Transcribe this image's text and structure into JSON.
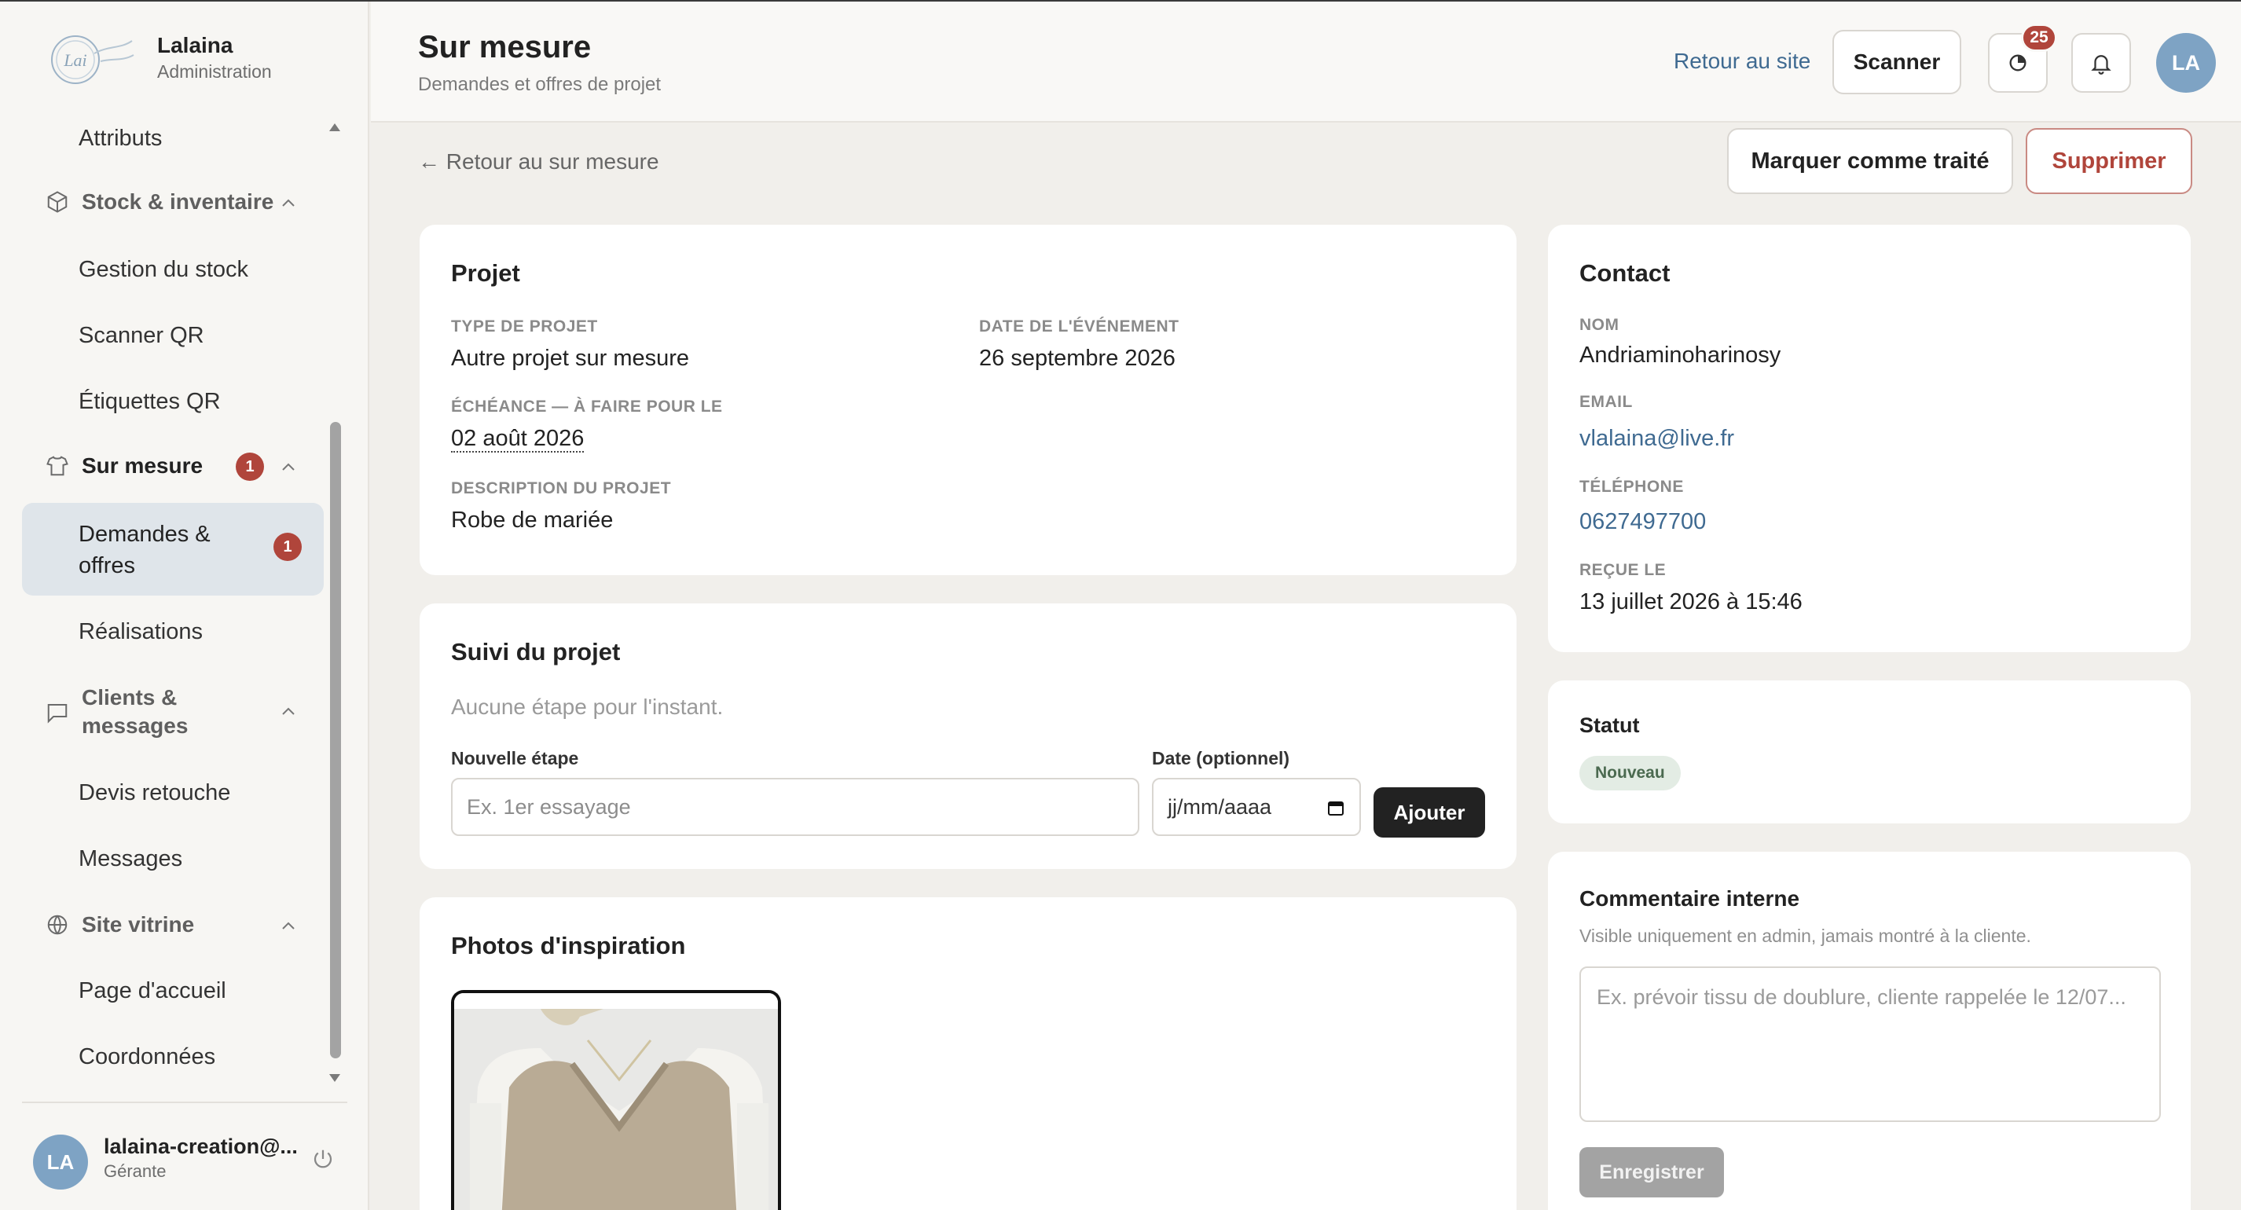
{
  "app": {
    "name": "Lalaina",
    "role": "Administration"
  },
  "sidebar": {
    "items": {
      "attributs": "Attributs",
      "stock_group": "Stock & inventaire",
      "gestion_stock": "Gestion du stock",
      "scanner_qr": "Scanner QR",
      "etiquettes_qr": "Étiquettes QR",
      "sur_mesure_group": "Sur mesure",
      "sur_mesure_badge": "1",
      "demandes_line1": "Demandes &",
      "demandes_line2": "offres",
      "demandes_badge": "1",
      "realisations": "Réalisations",
      "clients_line1": "Clients &",
      "clients_line2": "messages",
      "devis_retouche": "Devis retouche",
      "messages": "Messages",
      "site_group": "Site vitrine",
      "page_accueil": "Page d'accueil",
      "coordonnees": "Coordonnées"
    },
    "user": {
      "initials": "LA",
      "email": "lalaina-creation@...",
      "role": "Gérante"
    }
  },
  "header": {
    "title": "Sur mesure",
    "subtitle": "Demandes et offres de projet",
    "back_site": "Retour au site",
    "scanner": "Scanner",
    "notif_count": "25",
    "avatar": "LA"
  },
  "actions": {
    "back": "← Retour au sur mesure",
    "mark_done": "Marquer comme traité",
    "delete": "Supprimer"
  },
  "projet": {
    "title": "Projet",
    "type_label": "TYPE DE PROJET",
    "type_value": "Autre projet sur mesure",
    "date_label": "DATE DE L'ÉVÉNEMENT",
    "date_value": "26 septembre 2026",
    "echeance_label": "ÉCHÉANCE — À FAIRE POUR LE",
    "echeance_value": "02 août 2026",
    "desc_label": "DESCRIPTION DU PROJET",
    "desc_value": "Robe de mariée"
  },
  "suivi": {
    "title": "Suivi du projet",
    "empty": "Aucune étape pour l'instant.",
    "step_label": "Nouvelle étape",
    "step_placeholder": "Ex. 1er essayage",
    "date_label": "Date (optionnel)",
    "date_placeholder": "jj/mm/aaaa",
    "add": "Ajouter"
  },
  "photos": {
    "title": "Photos d'inspiration"
  },
  "contact": {
    "title": "Contact",
    "nom_label": "NOM",
    "nom": "Andriaminoharinosy",
    "email_label": "EMAIL",
    "email": "vlalaina@live.fr",
    "tel_label": "TÉLÉPHONE",
    "tel": "0627497700",
    "recu_label": "REÇUE LE",
    "recu": "13 juillet 2026 à 15:46"
  },
  "statut": {
    "title": "Statut",
    "value": "Nouveau",
    "color": "#e3ece4"
  },
  "commentaire": {
    "title": "Commentaire interne",
    "hint": "Visible uniquement en admin, jamais montré à la cliente.",
    "placeholder": "Ex. prévoir tissu de doublure, cliente rappelée le 12/07...",
    "save": "Enregistrer"
  },
  "colors": {
    "accent_red": "#b0453b",
    "link_blue": "#3f6a91",
    "dark_button": "#222222"
  }
}
